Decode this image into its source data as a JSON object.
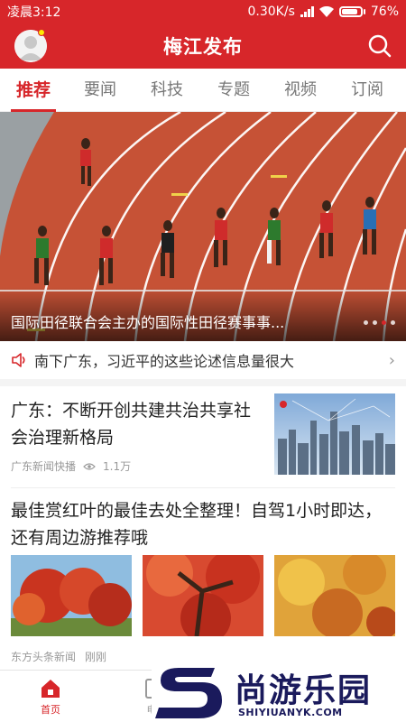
{
  "status_bar": {
    "time": "凌晨3:12",
    "speed": "0.30K/s",
    "battery": "76%",
    "battery_level": 0.76
  },
  "header": {
    "title": "梅江发布"
  },
  "tabs": [
    {
      "label": "推荐",
      "active": true
    },
    {
      "label": "要闻",
      "active": false
    },
    {
      "label": "科技",
      "active": false
    },
    {
      "label": "专题",
      "active": false
    },
    {
      "label": "视频",
      "active": false
    },
    {
      "label": "订阅",
      "active": false
    }
  ],
  "hero": {
    "caption": "国际田径联合会主办的国际性田径赛事事...",
    "page_count": 4,
    "active_page": 3
  },
  "notice": {
    "text": "南下广东，习近平的这些论述信息量很大"
  },
  "articles": [
    {
      "headline": "广东：不断开创共建共治共享社会治理新格局",
      "source": "广东新闻快播",
      "views": "1.1万"
    },
    {
      "headline": "最佳赏红叶的最佳去处全整理！自驾1小时即达，还有周边游推荐哦",
      "source": "东方头条新闻",
      "time": "刚刚"
    }
  ],
  "bottom_nav": [
    {
      "label": "首页",
      "icon": "home-icon",
      "active": true
    },
    {
      "label": "电",
      "icon": "phone-icon",
      "active": false
    }
  ],
  "watermark": {
    "text": "尚游乐园",
    "url": "SHIYIUANYK.COM"
  },
  "colors": {
    "brand": "#d7262a",
    "track": "#c9563a"
  }
}
